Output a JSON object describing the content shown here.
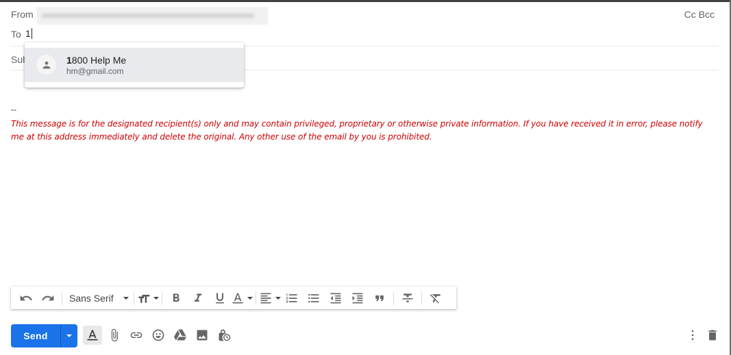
{
  "header": {
    "from_label": "From",
    "from_value_redacted": true,
    "cc_label": "Cc",
    "bcc_label": "Bcc",
    "to_label": "To",
    "to_value": "1",
    "subject_label": "Subject"
  },
  "autocomplete": {
    "items": [
      {
        "name_match": "1",
        "name_rest": "800 Help Me",
        "email": "hm@gmail.com",
        "icon": "person-icon"
      }
    ]
  },
  "body": {
    "signature_separator": "--",
    "disclaimer": "This message is for the designated recipient(s) only and may contain privileged, proprietary or otherwise private information. If you have received it in error, please notify me at this address immediately and delete the original. Any other use of the email by you is prohibited.",
    "disclaimer_color": "#cc0000"
  },
  "format_toolbar": {
    "font": "Sans Serif",
    "buttons": [
      "undo",
      "redo",
      "font-family",
      "font-size",
      "bold",
      "italic",
      "underline",
      "text-color",
      "align",
      "numbered-list",
      "bulleted-list",
      "indent-less",
      "indent-more",
      "quote",
      "strikethrough",
      "remove-formatting"
    ]
  },
  "actions": {
    "send_label": "Send",
    "accent": "#1a73e8",
    "icons": [
      "formatting-options",
      "attach-files",
      "insert-link",
      "insert-emoji",
      "insert-drive",
      "insert-photo",
      "confidential-mode",
      "more-options",
      "discard-draft"
    ]
  }
}
